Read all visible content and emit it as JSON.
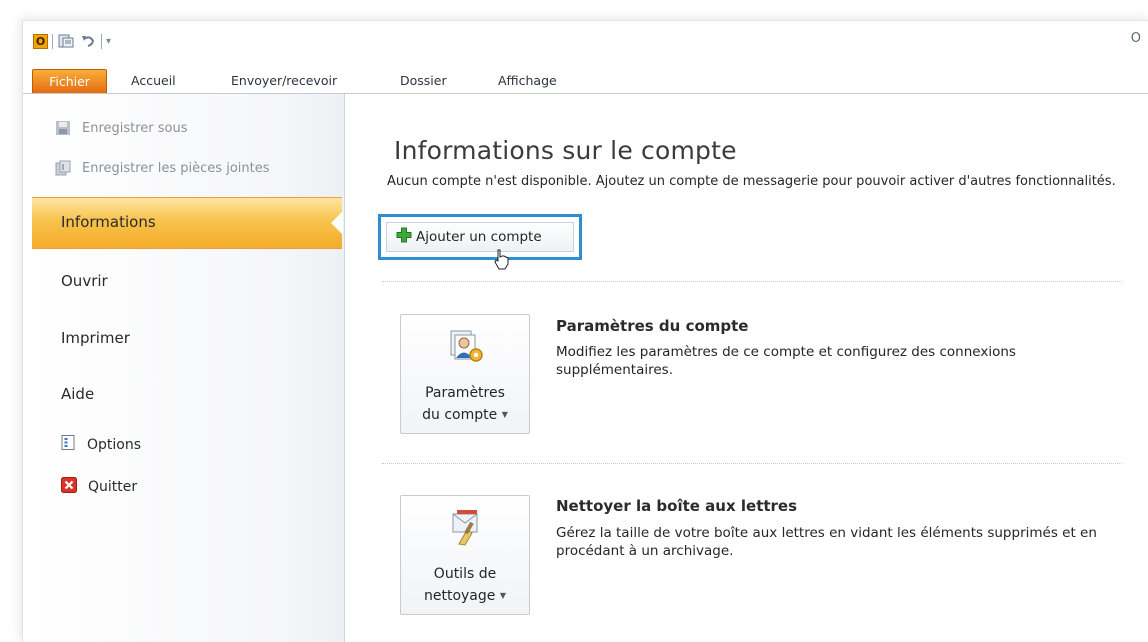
{
  "window": {
    "title_fragment": "O"
  },
  "quick_access": {
    "app_icon_letter": "O",
    "icons": [
      "outlook-app-icon",
      "send-receive-icon",
      "undo-icon",
      "customize-dropdown-icon"
    ]
  },
  "tabs": [
    {
      "label": "Fichier",
      "active": true
    },
    {
      "label": "Accueil"
    },
    {
      "label": "Envoyer/recevoir"
    },
    {
      "label": "Dossier"
    },
    {
      "label": "Affichage"
    }
  ],
  "backstage": {
    "commands": [
      {
        "label": "Enregistrer sous",
        "icon": "save-as-icon",
        "enabled": false
      },
      {
        "label": "Enregistrer les pièces jointes",
        "icon": "save-attachments-icon",
        "enabled": false
      }
    ],
    "selected": "Informations",
    "nav": [
      "Ouvrir",
      "Imprimer",
      "Aide"
    ],
    "bottom": [
      {
        "label": "Options",
        "icon": "options-icon"
      },
      {
        "label": "Quitter",
        "icon": "exit-icon"
      }
    ]
  },
  "content": {
    "heading": "Informations sur le compte",
    "description": "Aucun compte n'est disponible. Ajoutez un compte de messagerie pour pouvoir activer d'autres fonctionnalités.",
    "add_account_label": "Ajouter un compte",
    "sections": [
      {
        "button_line1": "Paramètres",
        "button_line2": "du compte",
        "title": "Paramètres du compte",
        "text": "Modifiez les paramètres de ce compte et configurez des connexions supplémentaires.",
        "icon": "account-settings-icon"
      },
      {
        "button_line1": "Outils de",
        "button_line2": "nettoyage",
        "title": "Nettoyer la boîte aux lettres",
        "text": "Gérez la taille de votre boîte aux lettres en vidant les éléments supprimés et en procédant à un archivage.",
        "icon": "cleanup-tools-icon"
      }
    ]
  },
  "colors": {
    "file_tab": "#e56a12",
    "selected_nav": "#f8c24d",
    "highlight_border": "#2f8fd0"
  }
}
